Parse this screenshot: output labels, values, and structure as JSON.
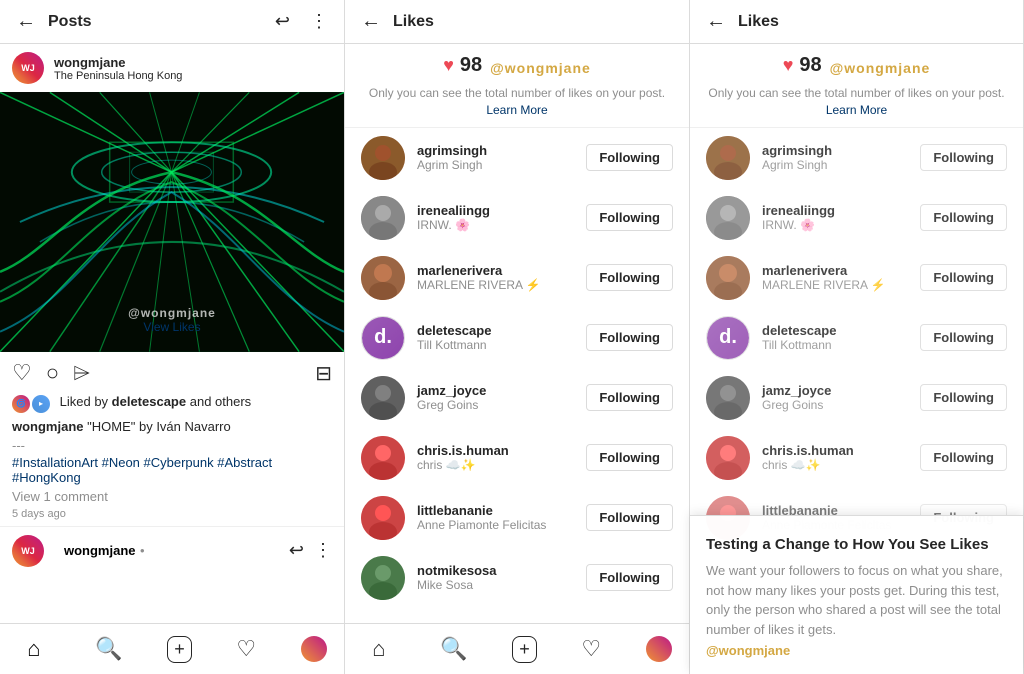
{
  "panel1": {
    "title": "Posts",
    "user": {
      "username": "wongmjane",
      "location": "The Peninsula Hong Kong"
    },
    "post": {
      "watermark": "@wongmjane",
      "view_likes": "View Likes",
      "liked_by": "Liked by",
      "bold_name": "deletescape",
      "and_others": "and others",
      "caption_user": "wongmjane",
      "caption_text": "\"HOME\" by Iván Navarro",
      "sep": "---",
      "tags": "#InstallationArt #Neon #Cyberpunk #Abstract #HongKong",
      "comment_link": "View 1 comment",
      "time": "5 days ago"
    },
    "nav": {
      "home": "⌂",
      "search": "🔍",
      "add": "+",
      "heart": "♡",
      "profile": ""
    }
  },
  "panel2": {
    "title": "Likes",
    "likes_count": "98",
    "watermark": "@wongmjane",
    "privacy_text": "Only you can see the total number of likes on your post.",
    "learn_more": "Learn More",
    "users": [
      {
        "handle": "agrimsingh",
        "name": "Agrim Singh",
        "avatar_class": "av-agrim",
        "following": "Following"
      },
      {
        "handle": "irenealiingg",
        "name": "IRNW. 🌸",
        "avatar_class": "av-irene",
        "following": "Following"
      },
      {
        "handle": "marlenerivera",
        "name": "MARLENE RIVERA ⚡",
        "avatar_class": "av-marlene",
        "following": "Following"
      },
      {
        "handle": "deletescape",
        "name": "Till Kottmann",
        "avatar_class": "av-delete",
        "following": "Following",
        "is_logo": true
      },
      {
        "handle": "jamz_joyce",
        "name": "Greg Goins",
        "avatar_class": "av-jamz",
        "following": "Following"
      },
      {
        "handle": "chris.is.human",
        "name": "chris ☁️✨",
        "avatar_class": "av-chris",
        "following": "Following"
      },
      {
        "handle": "littlebananie",
        "name": "Anne Piamonte Felicitas",
        "avatar_class": "av-little",
        "following": "Following"
      },
      {
        "handle": "notmikesosa",
        "name": "Mike Sosa",
        "avatar_class": "av-notmike",
        "following": "Following"
      }
    ]
  },
  "panel3": {
    "title": "Likes",
    "likes_count": "98",
    "watermark": "@wongmjane",
    "privacy_text": "Only you can see the total number of likes on your post.",
    "learn_more": "Learn More",
    "overlay": {
      "title": "Testing a Change to How You See Likes",
      "text": "We want your followers to focus on what you share, not how many likes your posts get. During this test, only the person who shared a post will see the total number of likes it gets.",
      "watermark": "@wongmjane"
    }
  }
}
